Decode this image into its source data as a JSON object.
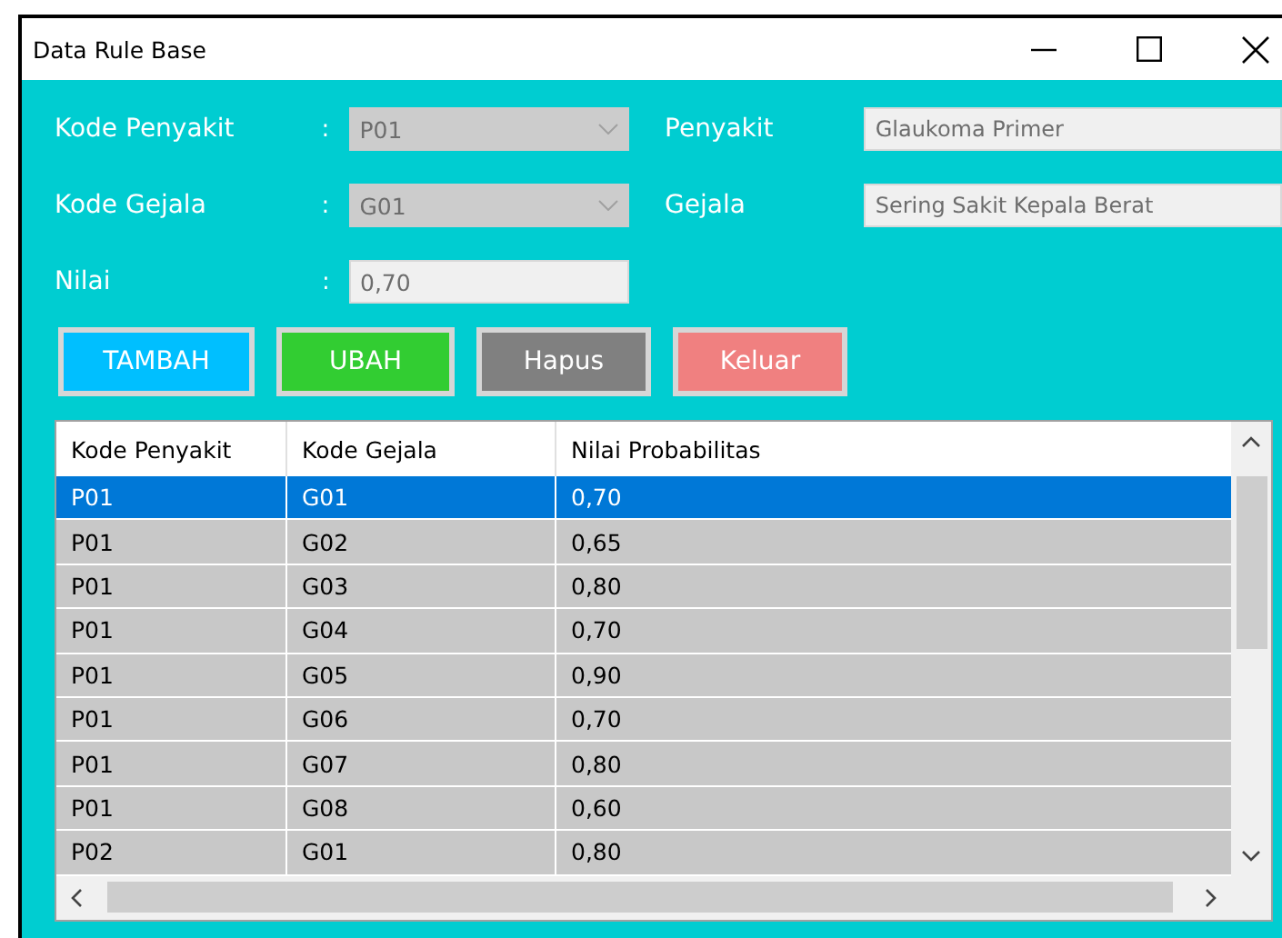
{
  "window": {
    "title": "Data Rule Base"
  },
  "form": {
    "fields": [
      {
        "label": "Kode Penyakit",
        "colon": ":",
        "kind": "combo",
        "value": "P01",
        "disabled": true
      },
      {
        "label": "Penyakit",
        "value": "Glaukoma Primer"
      },
      {
        "label": "Kode Gejala",
        "colon": ":",
        "kind": "combo",
        "value": "G01",
        "disabled": true
      },
      {
        "label": "Gejala",
        "value": "Sering Sakit Kepala Berat"
      },
      {
        "label": "Nilai",
        "colon": ":",
        "kind": "text",
        "value": "0,70"
      }
    ]
  },
  "buttons": [
    {
      "label": "TAMBAH",
      "color": "#00bfff"
    },
    {
      "label": "UBAH",
      "color": "#32cd32"
    },
    {
      "label": "Hapus",
      "color": "#808080"
    },
    {
      "label": "Keluar",
      "color": "#f08080"
    }
  ],
  "table": {
    "columns": [
      "Kode Penyakit",
      "Kode Gejala",
      "Nilai Probabilitas"
    ],
    "rows": [
      {
        "cells": [
          "P01",
          "G01",
          "0,70"
        ],
        "selected": true
      },
      {
        "cells": [
          "P01",
          "G02",
          "0,65"
        ],
        "selected": false
      },
      {
        "cells": [
          "P01",
          "G03",
          "0,80"
        ],
        "selected": false
      },
      {
        "cells": [
          "P01",
          "G04",
          "0,70"
        ],
        "selected": false
      },
      {
        "cells": [
          "P01",
          "G05",
          "0,90"
        ],
        "selected": false
      },
      {
        "cells": [
          "P01",
          "G06",
          "0,70"
        ],
        "selected": false
      },
      {
        "cells": [
          "P01",
          "G07",
          "0,80"
        ],
        "selected": false
      },
      {
        "cells": [
          "P01",
          "G08",
          "0,60"
        ],
        "selected": false
      },
      {
        "cells": [
          "P02",
          "G01",
          "0,80"
        ],
        "selected": false
      }
    ]
  }
}
